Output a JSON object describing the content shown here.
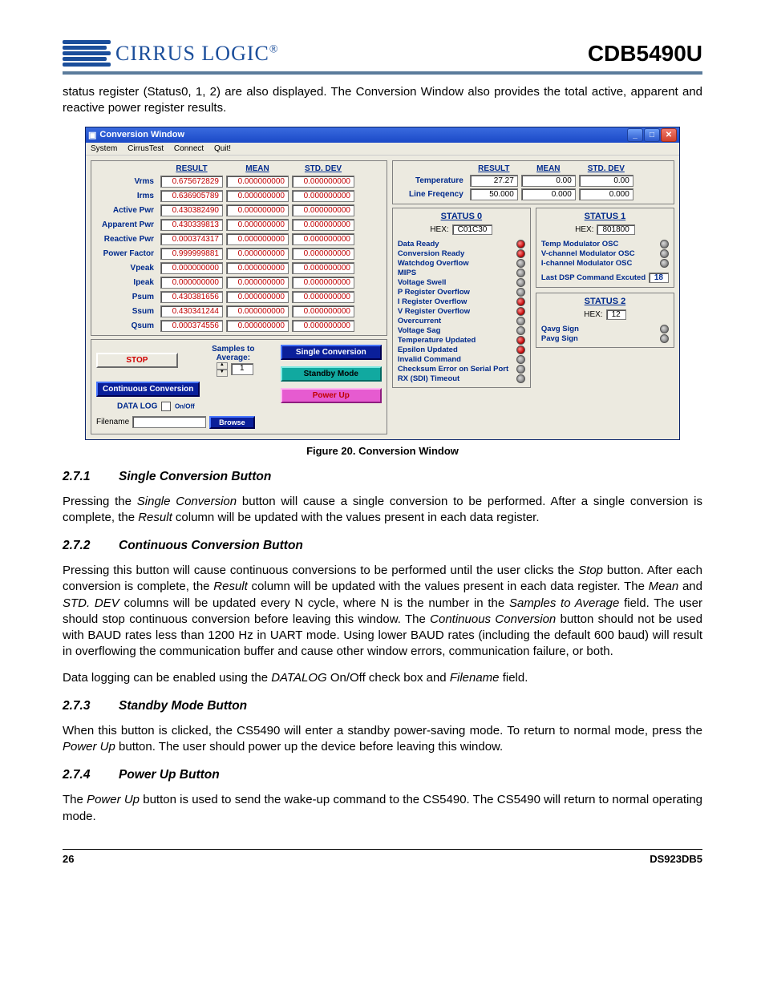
{
  "header": {
    "brand": "CIRRUS LOGIC",
    "trademark": "®",
    "doc": "CDB5490U"
  },
  "intro": "status register (Status0, 1, 2) are also displayed. The Conversion Window also provides the total active, apparent and reactive power register results.",
  "window": {
    "title": "Conversion Window",
    "menu": [
      "System",
      "CirrusTest",
      "Connect",
      "Quit!"
    ],
    "left_headers": [
      "RESULT",
      "MEAN",
      "STD. DEV"
    ],
    "rows": [
      {
        "label": "Vrms",
        "result": "0.675672829",
        "mean": "0.000000000",
        "std": "0.000000000"
      },
      {
        "label": "Irms",
        "result": "0.636905789",
        "mean": "0.000000000",
        "std": "0.000000000"
      },
      {
        "label": "Active Pwr",
        "result": "0.430382490",
        "mean": "0.000000000",
        "std": "0.000000000"
      },
      {
        "label": "Apparent Pwr",
        "result": "0.430339813",
        "mean": "0.000000000",
        "std": "0.000000000"
      },
      {
        "label": "Reactive Pwr",
        "result": "0.000374317",
        "mean": "0.000000000",
        "std": "0.000000000"
      },
      {
        "label": "Power Factor",
        "result": "0.999999881",
        "mean": "0.000000000",
        "std": "0.000000000"
      },
      {
        "label": "Vpeak",
        "result": "0.000000000",
        "mean": "0.000000000",
        "std": "0.000000000"
      },
      {
        "label": "Ipeak",
        "result": "0.000000000",
        "mean": "0.000000000",
        "std": "0.000000000"
      },
      {
        "label": "Psum",
        "result": "0.430381656",
        "mean": "0.000000000",
        "std": "0.000000000"
      },
      {
        "label": "Ssum",
        "result": "0.430341244",
        "mean": "0.000000000",
        "std": "0.000000000"
      },
      {
        "label": "Qsum",
        "result": "0.000374556",
        "mean": "0.000000000",
        "std": "0.000000000"
      }
    ],
    "controls": {
      "stop": "STOP",
      "cc": "Continuous Conversion",
      "samples_label": "Samples to Average:",
      "samples_value": "1",
      "datalog": "DATA LOG",
      "onoff": "On/Off",
      "filename_label": "Filename",
      "browse": "Browse",
      "single": "Single Conversion",
      "standby": "Standby Mode",
      "power": "Power Up"
    },
    "right_headers": [
      "RESULT",
      "MEAN",
      "STD. DEV"
    ],
    "right_rows": [
      {
        "label": "Temperature",
        "result": "27.27",
        "mean": "0.00",
        "std": "0.00"
      },
      {
        "label": "Line Freqency",
        "result": "50.000",
        "mean": "0.000",
        "std": "0.000"
      }
    ],
    "status0": {
      "title": "STATUS 0",
      "hex_label": "HEX:",
      "hex": "C01C30",
      "items": [
        {
          "name": "Data Ready",
          "on": true
        },
        {
          "name": "Conversion Ready",
          "on": true
        },
        {
          "name": "Watchdog Overflow",
          "on": false
        },
        {
          "name": "MIPS",
          "on": false
        },
        {
          "name": "Voltage Swell",
          "on": false
        },
        {
          "name": "P Register Overflow",
          "on": false
        },
        {
          "name": "I Register Overflow",
          "on": true
        },
        {
          "name": "V Register Overflow",
          "on": true
        },
        {
          "name": "Overcurrent",
          "on": false
        },
        {
          "name": "Voltage Sag",
          "on": false
        },
        {
          "name": "Temperature Updated",
          "on": true
        },
        {
          "name": "Epsilon Updated",
          "on": true
        },
        {
          "name": "Invalid Command",
          "on": false
        },
        {
          "name": "Checksum Error on Serial Port",
          "on": false
        },
        {
          "name": "RX (SDI) Timeout",
          "on": false
        }
      ]
    },
    "status1": {
      "title": "STATUS 1",
      "hex_label": "HEX:",
      "hex": "801800",
      "items": [
        {
          "name": "Temp Modulator OSC",
          "on": false
        },
        {
          "name": "V-channel Modulator OSC",
          "on": false
        },
        {
          "name": "I-channel Modulator OSC",
          "on": false
        }
      ],
      "last_cmd_label": "Last DSP Command Excuted",
      "last_cmd_value": "18"
    },
    "status2": {
      "title": "STATUS 2",
      "hex_label": "HEX:",
      "hex": "12",
      "items": [
        {
          "name": "Qavg Sign",
          "on": false
        },
        {
          "name": "Pavg Sign",
          "on": false
        }
      ]
    }
  },
  "caption": "Figure 20.  Conversion Window",
  "sections": {
    "s271": {
      "num": "2.7.1",
      "title": "Single Conversion Button",
      "body": "Pressing the Single Conversion button will cause a single conversion to be performed. After a single conversion is complete, the Result column will be updated with the values present in each data register."
    },
    "s272": {
      "num": "2.7.2",
      "title": "Continuous Conversion Button",
      "body1": "Pressing this button will cause continuous conversions to be performed until the user clicks the Stop button. After each conversion is complete, the Result column will be updated with the values present in each data register. The Mean and STD. DEV columns will be updated every N cycle, where N is the number in the Samples to Average field. The user should stop continuous conversion before leaving this window. The Continuous Conversion button should not be used with BAUD rates less than 1200 Hz in UART mode. Using lower BAUD rates (including the default 600 baud) will result in overflowing the communication buffer and cause other window errors, communication failure, or both.",
      "body2": "Data logging can be enabled using the DATALOG On/Off check box and Filename field."
    },
    "s273": {
      "num": "2.7.3",
      "title": "Standby Mode Button",
      "body": "When this button is clicked, the CS5490 will enter a standby power-saving mode. To return to normal mode, press the Power Up button. The user should power up the device before leaving this window."
    },
    "s274": {
      "num": "2.7.4",
      "title": "Power Up Button",
      "body": "The Power Up button is used to send the wake-up command to the CS5490. The CS5490 will return to normal operating mode."
    }
  },
  "footer": {
    "page": "26",
    "code": "DS923DB5"
  }
}
